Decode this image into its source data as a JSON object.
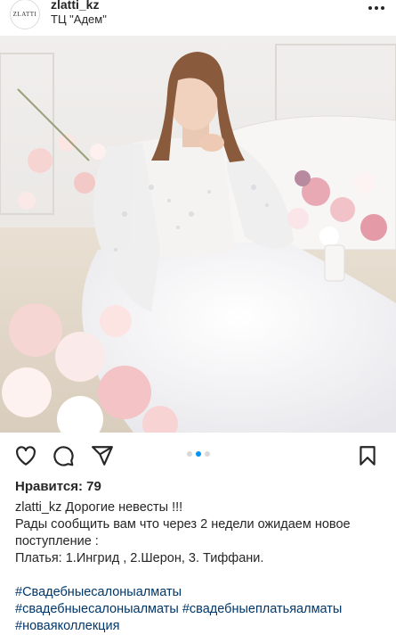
{
  "post": {
    "username": "zlatti_kz",
    "location": "ТЦ \"Адем\"",
    "avatar_text": "ZLATTI",
    "likes_label": "Нравится: 79",
    "carousel": {
      "count": 3,
      "active": 2
    },
    "caption": {
      "username": "zlatti_kz",
      "line1": "Дорогие невесты !!!",
      "line2": "Рады сообщить вам что через 2 недели ожидаем новое поступление :",
      "line3": "Платья: 1.Ингрид , 2.Шерон, 3. Тиффани."
    },
    "hashtags": {
      "tag1": "#Свадебныесалоныалматы",
      "tag2": "#свадебныесалоныалматы",
      "tag3": "#свадебныеплатьяалматы",
      "tag4": "#новаяколлекция"
    }
  },
  "icons": {
    "more": "more-horizontal-icon",
    "like": "heart-icon",
    "comment": "comment-icon",
    "share": "share-icon",
    "save": "bookmark-icon"
  },
  "colors": {
    "text": "#262626",
    "hashtag": "#00376b",
    "active_dot": "#0095f6",
    "inactive_dot": "#d8d8d8"
  }
}
